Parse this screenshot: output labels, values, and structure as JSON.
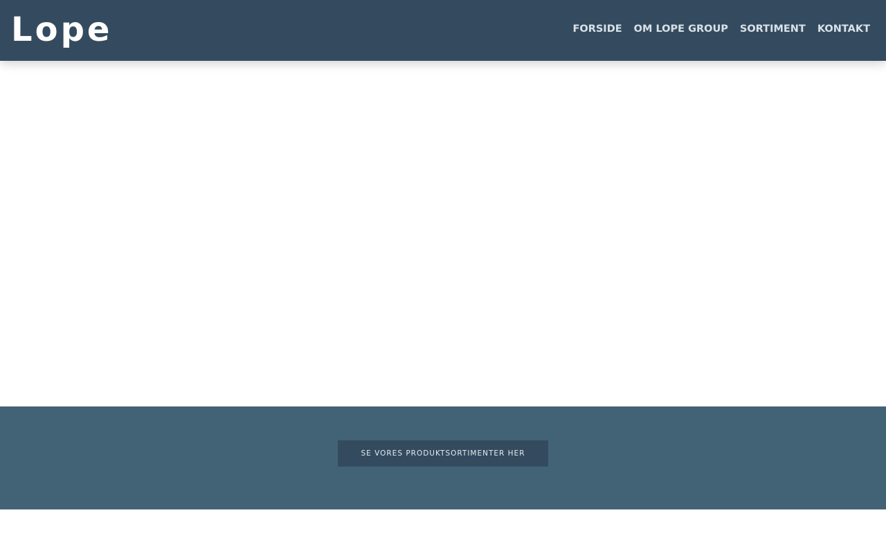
{
  "brand": {
    "logo_text": "Lope"
  },
  "nav": {
    "items": [
      {
        "label": "FORSIDE"
      },
      {
        "label": "OM LOPE GROUP"
      },
      {
        "label": "SORTIMENT"
      },
      {
        "label": "KONTAKT"
      }
    ]
  },
  "cta": {
    "label": "SE VORES PRODUKTSORTIMENTER HER"
  },
  "colors": {
    "header_bg": "#344b5f",
    "band_bg": "#426376",
    "button_bg": "#344b5f",
    "nav_text": "#d9e1e8"
  }
}
